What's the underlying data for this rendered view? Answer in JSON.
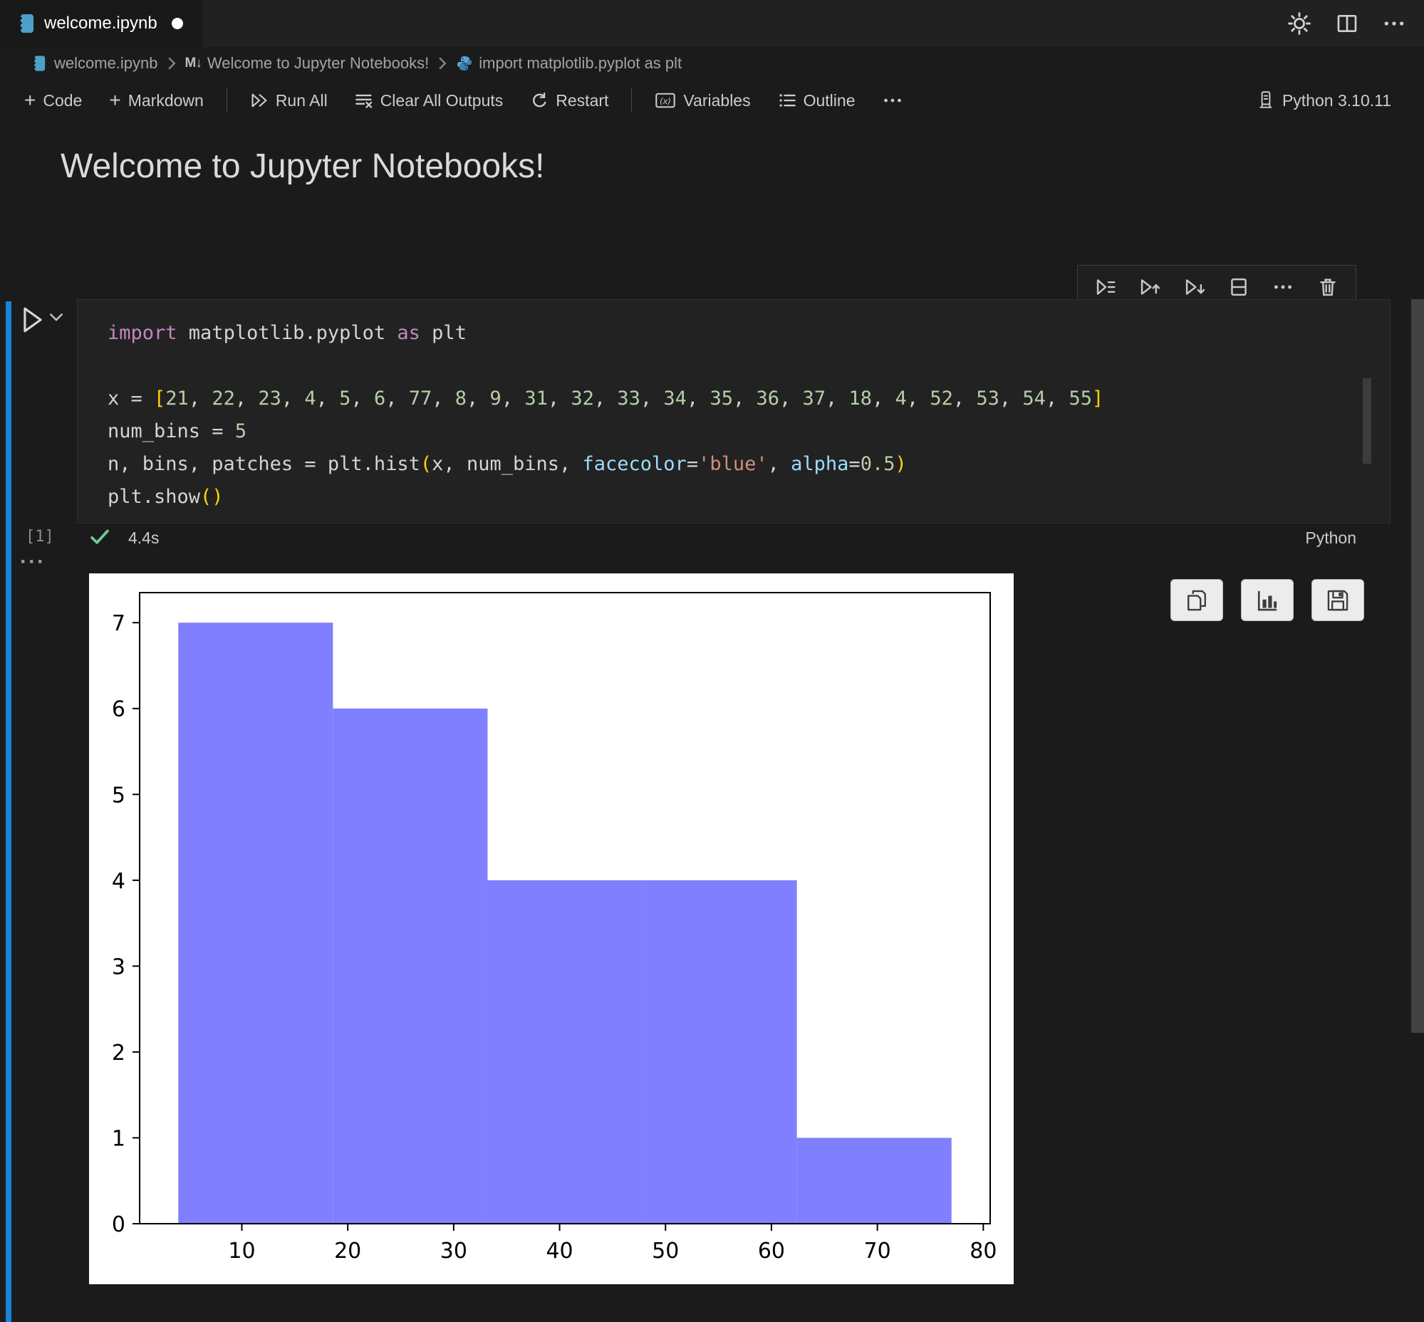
{
  "window": {
    "tab_title": "welcome.ipynb"
  },
  "breadcrumb": {
    "file": "welcome.ipynb",
    "section": "Welcome to Jupyter Notebooks!",
    "cell": "import matplotlib.pyplot as plt"
  },
  "toolbar": {
    "code_label": "Code",
    "markdown_label": "Markdown",
    "run_all_label": "Run All",
    "clear_outputs_label": "Clear All Outputs",
    "restart_label": "Restart",
    "variables_label": "Variables",
    "outline_label": "Outline",
    "kernel_label": "Python 3.10.11"
  },
  "icons": {
    "markdown_glyph": "M↓"
  },
  "markdown_cell": {
    "heading": "Welcome to Jupyter Notebooks!"
  },
  "code_cell": {
    "execution_count": "[1]",
    "status_duration": "4.4s",
    "language": "Python",
    "lines": [
      [
        {
          "t": "import",
          "c": "keyword"
        },
        {
          "t": " matplotlib.pyplot ",
          "c": "plain"
        },
        {
          "t": "as",
          "c": "keyword"
        },
        {
          "t": " plt",
          "c": "plain"
        }
      ],
      [],
      [
        {
          "t": "x = ",
          "c": "plain"
        },
        {
          "t": "[",
          "c": "bracket"
        },
        {
          "t": "21",
          "c": "number"
        },
        {
          "t": ", ",
          "c": "plain"
        },
        {
          "t": "22",
          "c": "number"
        },
        {
          "t": ", ",
          "c": "plain"
        },
        {
          "t": "23",
          "c": "number"
        },
        {
          "t": ", ",
          "c": "plain"
        },
        {
          "t": "4",
          "c": "number"
        },
        {
          "t": ", ",
          "c": "plain"
        },
        {
          "t": "5",
          "c": "number"
        },
        {
          "t": ", ",
          "c": "plain"
        },
        {
          "t": "6",
          "c": "number"
        },
        {
          "t": ", ",
          "c": "plain"
        },
        {
          "t": "77",
          "c": "number"
        },
        {
          "t": ", ",
          "c": "plain"
        },
        {
          "t": "8",
          "c": "number"
        },
        {
          "t": ", ",
          "c": "plain"
        },
        {
          "t": "9",
          "c": "number"
        },
        {
          "t": ", ",
          "c": "plain"
        },
        {
          "t": "31",
          "c": "number"
        },
        {
          "t": ", ",
          "c": "plain"
        },
        {
          "t": "32",
          "c": "number"
        },
        {
          "t": ", ",
          "c": "plain"
        },
        {
          "t": "33",
          "c": "number"
        },
        {
          "t": ", ",
          "c": "plain"
        },
        {
          "t": "34",
          "c": "number"
        },
        {
          "t": ", ",
          "c": "plain"
        },
        {
          "t": "35",
          "c": "number"
        },
        {
          "t": ", ",
          "c": "plain"
        },
        {
          "t": "36",
          "c": "number"
        },
        {
          "t": ", ",
          "c": "plain"
        },
        {
          "t": "37",
          "c": "number"
        },
        {
          "t": ", ",
          "c": "plain"
        },
        {
          "t": "18",
          "c": "number"
        },
        {
          "t": ", ",
          "c": "plain"
        },
        {
          "t": "4",
          "c": "number"
        },
        {
          "t": ", ",
          "c": "plain"
        },
        {
          "t": "52",
          "c": "number"
        },
        {
          "t": ", ",
          "c": "plain"
        },
        {
          "t": "53",
          "c": "number"
        },
        {
          "t": ", ",
          "c": "plain"
        },
        {
          "t": "54",
          "c": "number"
        },
        {
          "t": ", ",
          "c": "plain"
        },
        {
          "t": "55",
          "c": "number"
        },
        {
          "t": "]",
          "c": "bracket"
        }
      ],
      [
        {
          "t": "num_bins = ",
          "c": "plain"
        },
        {
          "t": "5",
          "c": "number"
        }
      ],
      [
        {
          "t": "n, bins, patches = plt.hist",
          "c": "plain"
        },
        {
          "t": "(",
          "c": "bracket"
        },
        {
          "t": "x, num_bins, ",
          "c": "plain"
        },
        {
          "t": "facecolor",
          "c": "param"
        },
        {
          "t": "=",
          "c": "plain"
        },
        {
          "t": "'blue'",
          "c": "string"
        },
        {
          "t": ", ",
          "c": "plain"
        },
        {
          "t": "alpha",
          "c": "param"
        },
        {
          "t": "=",
          "c": "plain"
        },
        {
          "t": "0.5",
          "c": "number"
        },
        {
          "t": ")",
          "c": "bracket"
        }
      ],
      [
        {
          "t": "plt.show",
          "c": "plain"
        },
        {
          "t": "()",
          "c": "bracket"
        }
      ]
    ]
  },
  "syntax_colors": {
    "keyword": "#C586C0",
    "plain": "#D4D4D4",
    "number": "#B5CEA8",
    "bracket": "#FFD700",
    "param": "#9CDCFE",
    "string": "#CE9178"
  },
  "chart_data": {
    "type": "bar",
    "subtype": "histogram",
    "title": "",
    "xlabel": "",
    "ylabel": "",
    "source_values": [
      21,
      22,
      23,
      4,
      5,
      6,
      77,
      8,
      9,
      31,
      32,
      33,
      34,
      35,
      36,
      37,
      18,
      4,
      52,
      53,
      54,
      55
    ],
    "num_bins": 5,
    "bin_edges": [
      4,
      18.6,
      33.2,
      47.8,
      62.4,
      77
    ],
    "counts": [
      7,
      6,
      4,
      4,
      1
    ],
    "xticks": [
      10,
      20,
      30,
      40,
      50,
      60,
      70,
      80
    ],
    "yticks": [
      0,
      1,
      2,
      3,
      4,
      5,
      6,
      7
    ],
    "xlim": [
      0.35,
      80.65
    ],
    "ylim": [
      0,
      7.35
    ],
    "bar_color": "#7f7fff",
    "background": "#ffffff",
    "grid": false,
    "legend": null
  }
}
